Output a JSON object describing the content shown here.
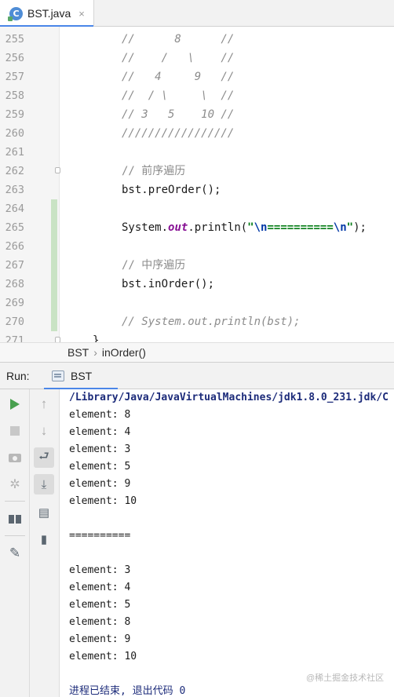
{
  "tabbar": {
    "file_tab": {
      "label": "BST.java",
      "icon": "class-icon",
      "icon_letter": "C",
      "close_glyph": "×"
    }
  },
  "editor": {
    "lines": [
      {
        "num": "255",
        "text": "//      8      //",
        "style": "comment"
      },
      {
        "num": "256",
        "text": "//    /   \\    //",
        "style": "comment"
      },
      {
        "num": "257",
        "text": "//   4     9   //",
        "style": "comment"
      },
      {
        "num": "258",
        "text": "//  / \\     \\  //",
        "style": "comment"
      },
      {
        "num": "259",
        "text": "// 3   5    10 //",
        "style": "comment"
      },
      {
        "num": "260",
        "text": "/////////////////",
        "style": "comment"
      },
      {
        "num": "261",
        "text": "",
        "style": "plain"
      },
      {
        "num": "262",
        "text": "// 前序遍历",
        "style": "comment-cn"
      },
      {
        "num": "263",
        "text": "bst.preOrder();",
        "style": "plain"
      },
      {
        "num": "264",
        "text": "",
        "style": "plain"
      },
      {
        "num": "265",
        "text": "",
        "style": "println"
      },
      {
        "num": "266",
        "text": "",
        "style": "plain"
      },
      {
        "num": "267",
        "text": "// 中序遍历",
        "style": "comment-cn"
      },
      {
        "num": "268",
        "text": "bst.inOrder();",
        "style": "plain"
      },
      {
        "num": "269",
        "text": "",
        "style": "plain"
      },
      {
        "num": "270",
        "text": "// System.out.println(bst);",
        "style": "comment"
      },
      {
        "num": "271",
        "text": "}",
        "style": "plain"
      }
    ],
    "println_line": {
      "prefix": "System.",
      "field": "out",
      "method": ".println(",
      "quote_open": "\"",
      "esc1": "\\n",
      "body": "==========",
      "esc2": "\\n",
      "quote_close": "\"",
      "suffix": ");"
    }
  },
  "breadcrumb": {
    "class_name": "BST",
    "separator": "›",
    "method_name": "inOrder()"
  },
  "run_panel": {
    "label": "Run:",
    "tab_label": "BST",
    "accent": "#4a86e8"
  },
  "console": {
    "lines": [
      {
        "text": "/Library/Java/JavaVirtualMachines/jdk1.8.0_231.jdk/C",
        "style": "path"
      },
      {
        "text": "element: 8",
        "style": "out"
      },
      {
        "text": "element: 4",
        "style": "out"
      },
      {
        "text": "element: 3",
        "style": "out"
      },
      {
        "text": "element: 5",
        "style": "out"
      },
      {
        "text": "element: 9",
        "style": "out"
      },
      {
        "text": "element: 10",
        "style": "out"
      },
      {
        "text": "",
        "style": "out"
      },
      {
        "text": "==========",
        "style": "out"
      },
      {
        "text": "",
        "style": "out"
      },
      {
        "text": "element: 3",
        "style": "out"
      },
      {
        "text": "element: 4",
        "style": "out"
      },
      {
        "text": "element: 5",
        "style": "out"
      },
      {
        "text": "element: 8",
        "style": "out"
      },
      {
        "text": "element: 9",
        "style": "out"
      },
      {
        "text": "element: 10",
        "style": "out"
      },
      {
        "text": "",
        "style": "out"
      },
      {
        "text": "进程已结束, 退出代码 0",
        "style": "exit"
      }
    ]
  },
  "watermark": "@稀土掘金技术社区"
}
